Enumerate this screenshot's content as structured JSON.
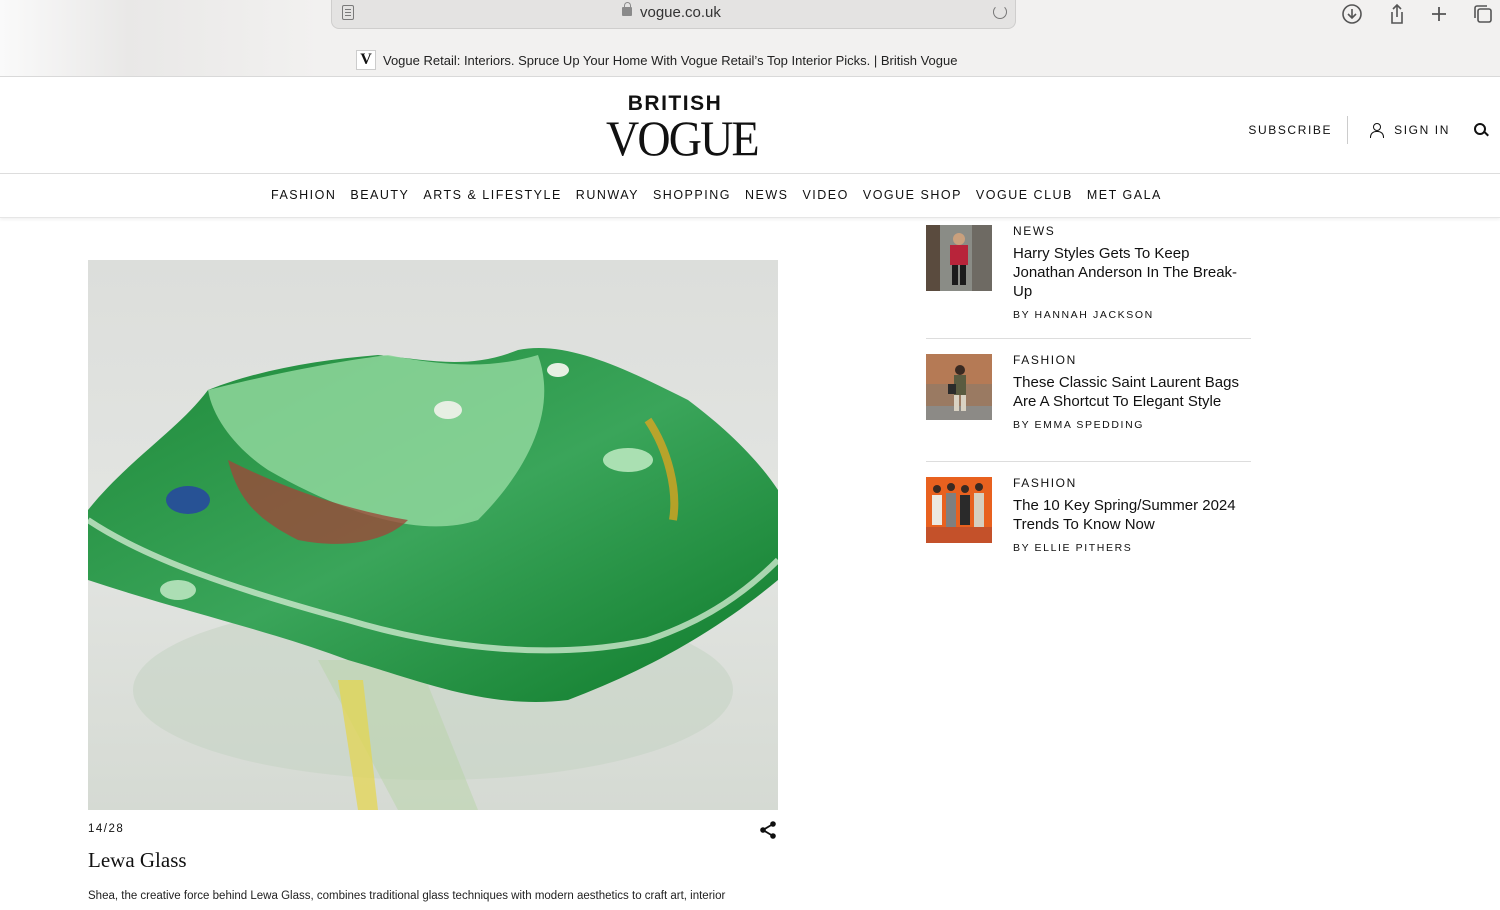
{
  "browser": {
    "url": "vogue.co.uk",
    "tab_title": "Vogue Retail: Interiors. Spruce Up Your Home With Vogue Retail’s Top Interior Picks. | British Vogue",
    "favicon_letter": "V"
  },
  "header": {
    "brand_top": "BRITISH",
    "brand_main": "VOGUE",
    "subscribe": "SUBSCRIBE",
    "sign_in": "SIGN IN"
  },
  "nav": [
    "FASHION",
    "BEAUTY",
    "ARTS & LIFESTYLE",
    "RUNWAY",
    "SHOPPING",
    "NEWS",
    "VIDEO",
    "VOGUE SHOP",
    "VOGUE CLUB",
    "MET GALA"
  ],
  "gallery": {
    "counter": "14/28",
    "title": "Lewa Glass",
    "description": "Shea, the creative force behind Lewa Glass, combines traditional glass techniques with modern aesthetics to craft art, interior"
  },
  "sidebar": [
    {
      "category": "NEWS",
      "headline": "Harry Styles Gets To Keep Jonathan Anderson In The Break-Up",
      "byline": "BY HANNAH JACKSON"
    },
    {
      "category": "FASHION",
      "headline": "These Classic Saint Laurent Bags Are A Shortcut To Elegant Style",
      "byline": "BY EMMA SPEDDING"
    },
    {
      "category": "FASHION",
      "headline": "The 10 Key Spring/Summer 2024 Trends To Know Now",
      "byline": "BY ELLIE PITHERS"
    }
  ]
}
